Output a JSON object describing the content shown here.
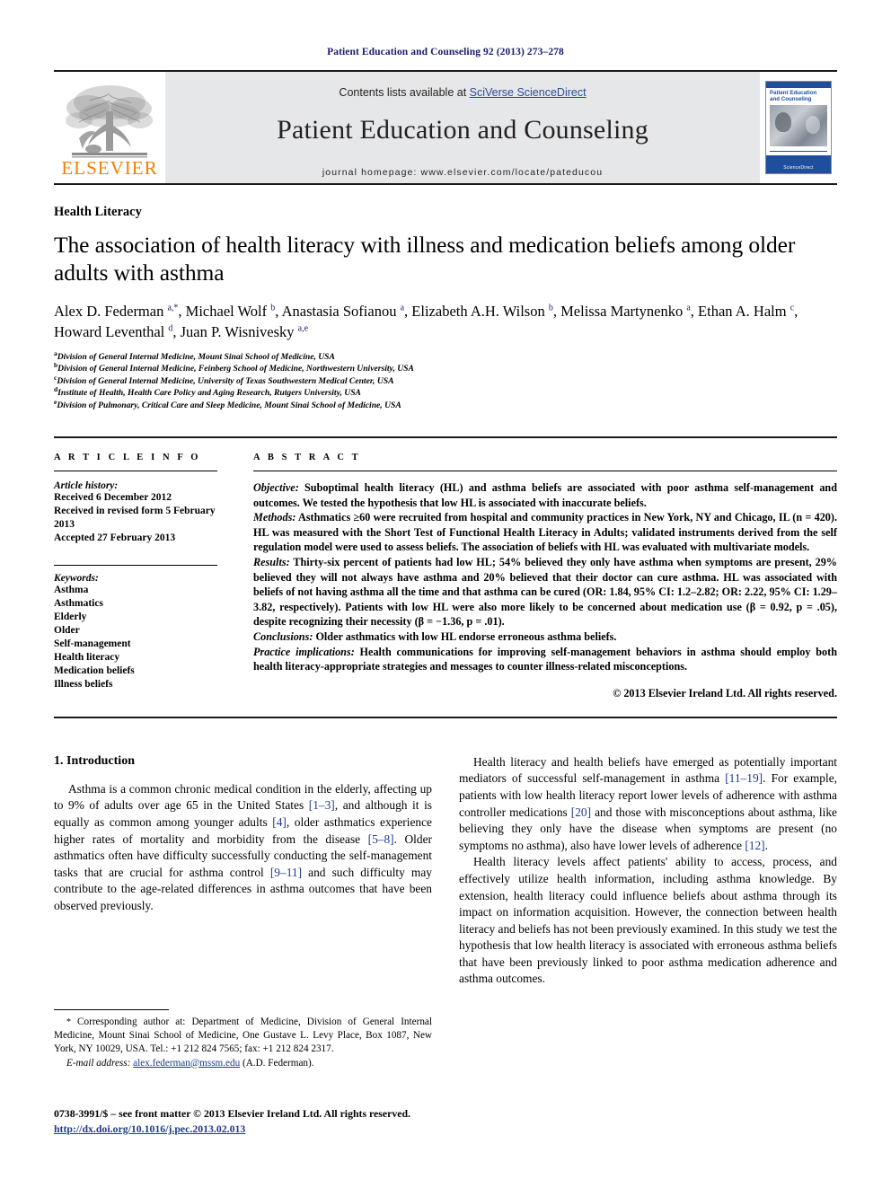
{
  "running_head": "Patient Education and Counseling 92 (2013) 273–278",
  "masthead": {
    "publisher_logo_name": "elsevier-tree-logo",
    "publisher_wordmark": "ELSEVIER",
    "contents_prefix": "Contents lists available at ",
    "contents_link": "SciVerse ScienceDirect",
    "journal_name": "Patient Education and Counseling",
    "homepage_line": "journal homepage: www.elsevier.com/locate/pateducou",
    "cover": {
      "title": "Patient Education and Counseling",
      "footer": "ScienceDirect"
    }
  },
  "article": {
    "kicker": "Health Literacy",
    "title": "The association of health literacy with illness and medication beliefs among older adults with asthma",
    "authors_html": "Alex D. Federman <sup>a,*</sup>, Michael Wolf <sup>b</sup>, Anastasia Sofianou <sup>a</sup>, Elizabeth A.H. Wilson <sup>b</sup>, Melissa Martynenko <sup>a</sup>, Ethan A. Halm <sup>c</sup>, Howard Leventhal <sup>d</sup>, Juan P. Wisnivesky <sup>a,e</sup>",
    "affiliations": [
      {
        "marker": "a",
        "text": "Division of General Internal Medicine, Mount Sinai School of Medicine, USA"
      },
      {
        "marker": "b",
        "text": "Division of General Internal Medicine, Feinberg School of Medicine, Northwestern University, USA"
      },
      {
        "marker": "c",
        "text": "Division of General Internal Medicine, University of Texas Southwestern Medical Center, USA"
      },
      {
        "marker": "d",
        "text": "Institute of Health, Health Care Policy and Aging Research, Rutgers University, USA"
      },
      {
        "marker": "e",
        "text": "Division of Pulmonary, Critical Care and Sleep Medicine, Mount Sinai School of Medicine, USA"
      }
    ]
  },
  "article_info": {
    "heading": "A R T I C L E    I N F O",
    "history_label": "Article history:",
    "history": [
      "Received 6 December 2012",
      "Received in revised form 5 February 2013",
      "Accepted 27 February 2013"
    ],
    "keywords_label": "Keywords:",
    "keywords": [
      "Asthma",
      "Asthmatics",
      "Elderly",
      "Older",
      "Self-management",
      "Health literacy",
      "Medication beliefs",
      "Illness beliefs"
    ]
  },
  "abstract": {
    "heading": "A B S T R A C T",
    "objective_label": "Objective:",
    "objective": " Suboptimal health literacy (HL) and asthma beliefs are associated with poor asthma self-management and outcomes. We tested the hypothesis that low HL is associated with inaccurate beliefs.",
    "methods_label": "Methods:",
    "methods": " Asthmatics ≥60 were recruited from hospital and community practices in New York, NY and Chicago, IL (n = 420). HL was measured with the Short Test of Functional Health Literacy in Adults; validated instruments derived from the self regulation model were used to assess beliefs. The association of beliefs with HL was evaluated with multivariate models.",
    "results_label": "Results:",
    "results": " Thirty-six percent of patients had low HL; 54% believed they only have asthma when symptoms are present, 29% believed they will not always have asthma and 20% believed that their doctor can cure asthma. HL was associated with beliefs of not having asthma all the time and that asthma can be cured (OR: 1.84, 95% CI: 1.2–2.82; OR: 2.22, 95% CI: 1.29–3.82, respectively). Patients with low HL were also more likely to be concerned about medication use (β = 0.92, p = .05), despite recognizing their necessity (β = −1.36, p = .01).",
    "conclusions_label": "Conclusions:",
    "conclusions": " Older asthmatics with low HL endorse erroneous asthma beliefs.",
    "implications_label": "Practice implications:",
    "implications": " Health communications for improving self-management behaviors in asthma should employ both health literacy-appropriate strategies and messages to counter illness-related misconceptions.",
    "copyright": "© 2013 Elsevier Ireland Ltd. All rights reserved."
  },
  "introduction": {
    "heading": "1. Introduction",
    "left_paragraphs": [
      "Asthma is a common chronic medical condition in the elderly, affecting up to 9% of adults over age 65 in the United States [1–3], and although it is equally as common among younger adults [4], older asthmatics experience higher rates of mortality and morbidity from the disease [5–8]. Older asthmatics often have difficulty successfully conducting the self-management tasks that are crucial for asthma control [9–11] and such difficulty may contribute to the age-related differences in asthma outcomes that have been observed previously."
    ],
    "right_paragraphs": [
      "Health literacy and health beliefs have emerged as potentially important mediators of successful self-management in asthma [11–19]. For example, patients with low health literacy report lower levels of adherence with asthma controller medications [20] and those with misconceptions about asthma, like believing they only have the disease when symptoms are present (no symptoms no asthma), also have lower levels of adherence [12].",
      "Health literacy levels affect patients' ability to access, process, and effectively utilize health information, including asthma knowledge. By extension, health literacy could influence beliefs about asthma through its impact on information acquisition. However, the connection between health literacy and beliefs has not been previously examined. In this study we test the hypothesis that low health literacy is associated with erroneous asthma beliefs that have been previously linked to poor asthma medication adherence and asthma outcomes."
    ]
  },
  "footnote": {
    "star": "*",
    "text": " Corresponding author at: Department of Medicine, Division of General Internal Medicine, Mount Sinai School of Medicine, One Gustave L. Levy Place, Box 1087, New York, NY 10029, USA. Tel.: +1 212 824 7565; fax: +1 212 824 2317.",
    "email_label": "E-mail address:",
    "email": "alex.federman@mssm.edu",
    "email_suffix": " (A.D. Federman)."
  },
  "colophon": {
    "line": "0738-3991/$ – see front matter © 2013 Elsevier Ireland Ltd. All rights reserved.",
    "doi": "http://dx.doi.org/10.1016/j.pec.2013.02.013"
  }
}
